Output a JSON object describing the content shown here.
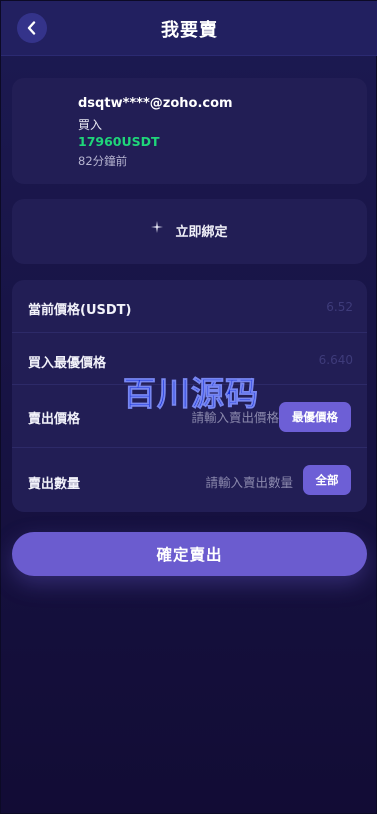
{
  "header": {
    "title": "我要賣"
  },
  "order": {
    "email": "dsqtw****@zoho.com",
    "type": "買入",
    "amount": "17960USDT",
    "time_ago": "82分鐘前"
  },
  "bind": {
    "label": "立即綁定"
  },
  "form": {
    "current_price_label": "當前價格(USDT)",
    "current_price_value": "6.52",
    "best_buy_price_label": "買入最優價格",
    "best_buy_price_value": "6.640",
    "sell_price_label": "賣出價格",
    "sell_price_placeholder": "請輸入賣出價格",
    "best_price_button": "最優價格",
    "sell_qty_label": "賣出數量",
    "sell_qty_placeholder": "請輸入賣出數量",
    "all_button": "全部"
  },
  "submit": {
    "label": "確定賣出"
  },
  "watermark": {
    "text": "百川源码"
  },
  "colors": {
    "accent": "#6b5ccf",
    "amount_green": "#1fd67a",
    "background": "#14103a",
    "card": "#221e55",
    "watermark_blue": "#1533e6"
  },
  "icons": {
    "back": "chevron-left-icon",
    "bind": "sparkle-icon"
  }
}
